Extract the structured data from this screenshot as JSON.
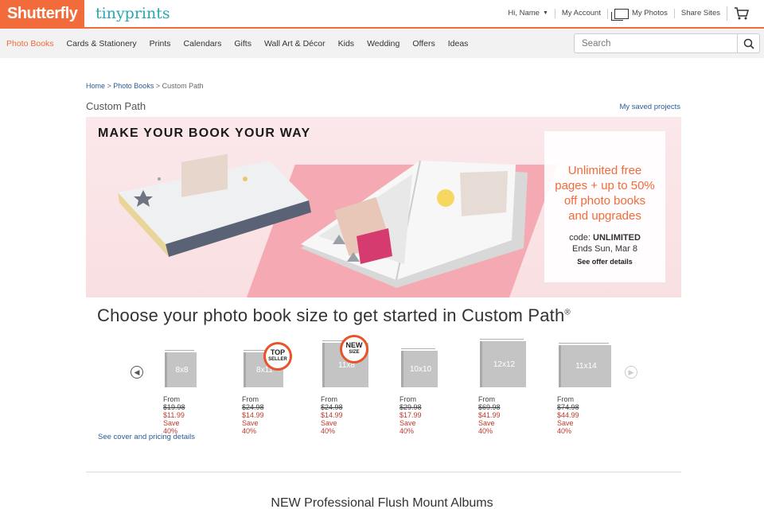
{
  "header": {
    "logo_primary": "Shutterfly",
    "logo_secondary": "tinyprints",
    "user_greeting": "Hi, Name",
    "my_account": "My Account",
    "my_photos": "My Photos",
    "share_sites": "Share Sites",
    "accent_color": "#f26b3a"
  },
  "nav": {
    "items": [
      {
        "label": "Photo Books",
        "active": true
      },
      {
        "label": "Cards & Stationery"
      },
      {
        "label": "Prints"
      },
      {
        "label": "Calendars"
      },
      {
        "label": "Gifts"
      },
      {
        "label": "Wall Art & Décor"
      },
      {
        "label": "Kids"
      },
      {
        "label": "Wedding"
      },
      {
        "label": "Offers"
      },
      {
        "label": "Ideas"
      }
    ],
    "search_placeholder": "Search"
  },
  "breadcrumb": {
    "home": "Home",
    "sep1": " > ",
    "photo_books": "Photo Books",
    "sep2": " > ",
    "current": "Custom Path"
  },
  "page": {
    "title": "Custom Path",
    "saved_projects": "My saved projects"
  },
  "hero": {
    "headline": "MAKE YOUR BOOK YOUR WAY",
    "promo_line1": "Unlimited free",
    "promo_line2": "pages + up to 50%",
    "promo_line3": "off photo books",
    "promo_line4": "and upgrades",
    "code_label": "code: ",
    "code_value": "UNLIMITED",
    "ends": "Ends Sun, Mar 8",
    "offer_details": "See offer details"
  },
  "choose": {
    "heading": "Choose your photo book size to get started in Custom Path",
    "reg": "®"
  },
  "sizes": [
    {
      "label": "8x8",
      "from_label": "From ",
      "was": "$19.98",
      "price": "$11.99",
      "save": "Save 40%"
    },
    {
      "label": "8x11",
      "from_label": "From ",
      "was": "$24.98",
      "price": "$14.99",
      "save": "Save 40%",
      "badge_line1": "TOP",
      "badge_line2": "SELLER"
    },
    {
      "label": "11x8",
      "from_label": "From ",
      "was": "$24.98",
      "price": "$14.99",
      "save": "Save 40%",
      "badge_line1": "NEW",
      "badge_line2": "SIZE"
    },
    {
      "label": "10x10",
      "from_label": "From ",
      "was": "$29.98",
      "price": "$17.99",
      "save": "Save 40%"
    },
    {
      "label": "12x12",
      "from_label": "From ",
      "was": "$69.98",
      "price": "$41.99",
      "save": "Save 40%"
    },
    {
      "label": "11x14",
      "from_label": "From ",
      "was": "$74.98",
      "price": "$44.99",
      "save": "Save 40%"
    }
  ],
  "links": {
    "see_cover": "See cover and pricing details"
  },
  "bottom": {
    "heading": "NEW Professional Flush Mount Albums"
  }
}
